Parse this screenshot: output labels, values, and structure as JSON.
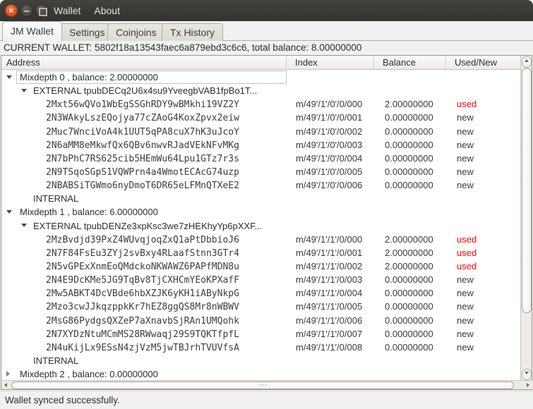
{
  "window": {
    "titlebar": {
      "menu_items": [
        {
          "label": "Wallet"
        },
        {
          "label": "About"
        }
      ]
    },
    "tabs": [
      {
        "label": "JM Wallet",
        "active": true
      },
      {
        "label": "Settings",
        "active": false
      },
      {
        "label": "Coinjoins",
        "active": false
      },
      {
        "label": "Tx History",
        "active": false
      }
    ],
    "wallet_banner": "CURRENT WALLET: 5802f18a13543faec6a879ebd3c6c6, total balance: 8.00000000",
    "status_bar": "Wallet synced successfully."
  },
  "icons": {
    "close": "×",
    "hscroll_grip": "⋯"
  },
  "colors": {
    "titlebar": "#3a3834",
    "close_button": "#e15420",
    "used_status": "#ff0000",
    "new_status": "#3a3a3a"
  },
  "table": {
    "columns": [
      "Address",
      "Index",
      "Balance",
      "Used/New"
    ],
    "mixdepths": [
      {
        "label": "Mixdepth 0 , balance: 2.00000000",
        "arrow": "expanded",
        "focused": true,
        "children": [
          {
            "label": "EXTERNAL tpubDECq2U6x4su9YveegbVAB1fpBo1T...",
            "arrow": "expanded",
            "addresses": [
              {
                "address": "2Mxt56wQVo1WbEgSSGhRDY9wBMkhi19VZ2Y",
                "index": "m/49'/1'/0'/0/000",
                "balance": "2.00000000",
                "status": "used"
              },
              {
                "address": "2N3WAkyLszEQojya77cZAoG4KoxZpvx2eiw",
                "index": "m/49'/1'/0'/0/001",
                "balance": "0.00000000",
                "status": "new"
              },
              {
                "address": "2Muc7WnciVoA4k1UUT5qPA8cuX7hK3uJcoY",
                "index": "m/49'/1'/0'/0/002",
                "balance": "0.00000000",
                "status": "new"
              },
              {
                "address": "2N6aMM8eMkwfQx6QBv6nwvRJadVEkNFvMKg",
                "index": "m/49'/1'/0'/0/003",
                "balance": "0.00000000",
                "status": "new"
              },
              {
                "address": "2N7bPhC7RS625cib5HEmWu64Lpu1GTz7r3s",
                "index": "m/49'/1'/0'/0/004",
                "balance": "0.00000000",
                "status": "new"
              },
              {
                "address": "2N9TSqoSGpS1VQWPrn4a4WmotECAcG74uzp",
                "index": "m/49'/1'/0'/0/005",
                "balance": "0.00000000",
                "status": "new"
              },
              {
                "address": "2NBABSiTGWmo6nyDmoT6DR65eLFMnQTXeE2",
                "index": "m/49'/1'/0'/0/006",
                "balance": "0.00000000",
                "status": "new"
              }
            ]
          },
          {
            "label": "INTERNAL",
            "arrow": "none",
            "addresses": []
          }
        ]
      },
      {
        "label": "Mixdepth 1 , balance: 6.00000000",
        "arrow": "expanded",
        "focused": false,
        "children": [
          {
            "label": "EXTERNAL tpubDENZe3xpKsc3we7zHEKhyYp6pXXF...",
            "arrow": "expanded",
            "addresses": [
              {
                "address": "2MzBvdjd39PxZ4WUvqjoqZxQ1aPtDbbioJ6",
                "index": "m/49'/1'/1'/0/000",
                "balance": "2.00000000",
                "status": "used"
              },
              {
                "address": "2N7F84FsEu3ZYj2svBxy4RLaafStnn3GTr4",
                "index": "m/49'/1'/1'/0/001",
                "balance": "2.00000000",
                "status": "used"
              },
              {
                "address": "2N5vGPExXnmEoQMdckoNKWAWZ6PAPfMDN8u",
                "index": "m/49'/1'/1'/0/002",
                "balance": "2.00000000",
                "status": "used"
              },
              {
                "address": "2N4E9DcKMe5JG9TqBv8TjCXHCmYEoKPXafF",
                "index": "m/49'/1'/1'/0/003",
                "balance": "0.00000000",
                "status": "new"
              },
              {
                "address": "2Mw5ABKT4DcVBde6hbXZJK6yKH1iAByNkpG",
                "index": "m/49'/1'/1'/0/004",
                "balance": "0.00000000",
                "status": "new"
              },
              {
                "address": "2Mzo3cwJJkqzppkKr7hEZ8ggQS8Mr8nWBWV",
                "index": "m/49'/1'/1'/0/005",
                "balance": "0.00000000",
                "status": "new"
              },
              {
                "address": "2MsG86PydgsQXZeP7aXnavbSjRAn1UMQohk",
                "index": "m/49'/1'/1'/0/006",
                "balance": "0.00000000",
                "status": "new"
              },
              {
                "address": "2N7XYDzNtuMCmMS28RWwaqj29S9TQKTfpfL",
                "index": "m/49'/1'/1'/0/007",
                "balance": "0.00000000",
                "status": "new"
              },
              {
                "address": "2N4uKijLx9ESsN4zjVzM5jwTBJrhTVUVfsA",
                "index": "m/49'/1'/1'/0/008",
                "balance": "0.00000000",
                "status": "new"
              }
            ]
          },
          {
            "label": "INTERNAL",
            "arrow": "none",
            "addresses": []
          }
        ]
      },
      {
        "label": "Mixdepth 2 , balance: 0.00000000",
        "arrow": "collapsed",
        "focused": false,
        "children": []
      }
    ]
  }
}
